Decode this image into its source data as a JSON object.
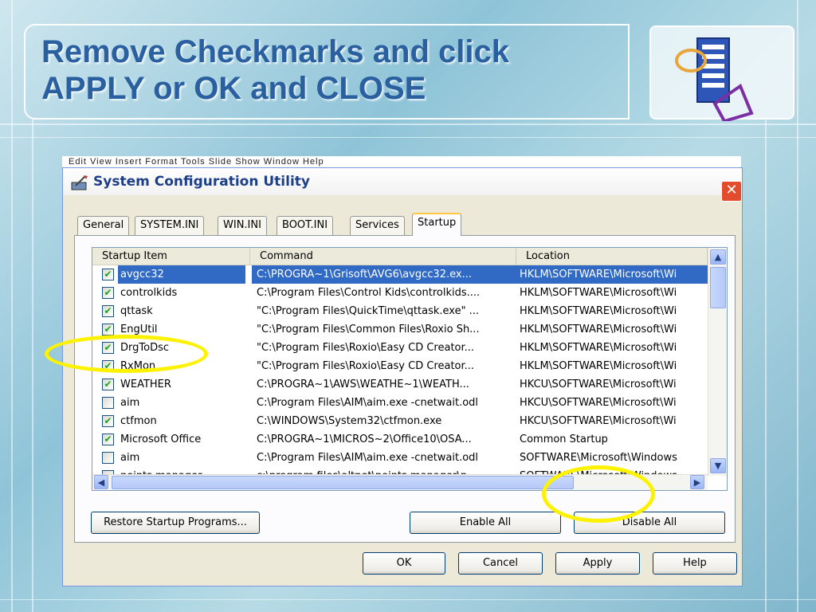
{
  "slide": {
    "title": "Remove Checkmarks and click APPLY or OK and CLOSE"
  },
  "background_menu": "Edit   View   Insert   Format   Tools   Slide Show   Window   Help",
  "window": {
    "title": "System Configuration Utility",
    "close": "✕"
  },
  "tabs": [
    "General",
    "SYSTEM.INI",
    "WIN.INI",
    "BOOT.INI",
    "Services",
    "Startup"
  ],
  "active_tab": "Startup",
  "list": {
    "headers": [
      "Startup Item",
      "Command",
      "Location"
    ],
    "rows": [
      {
        "checked": true,
        "item": "avgcc32",
        "command": "C:\\PROGRA~1\\Grisoft\\AVG6\\avgcc32.ex...",
        "location": "HKLM\\SOFTWARE\\Microsoft\\Wi",
        "selected": true
      },
      {
        "checked": true,
        "item": "controlkids",
        "command": "C:\\Program Files\\Control Kids\\controlkids....",
        "location": "HKLM\\SOFTWARE\\Microsoft\\Wi"
      },
      {
        "checked": true,
        "item": "qttask",
        "command": "\"C:\\Program Files\\QuickTime\\qttask.exe\" ...",
        "location": "HKLM\\SOFTWARE\\Microsoft\\Wi"
      },
      {
        "checked": true,
        "item": "EngUtil",
        "command": "\"C:\\Program Files\\Common Files\\Roxio Sh...",
        "location": "HKLM\\SOFTWARE\\Microsoft\\Wi"
      },
      {
        "checked": true,
        "item": "DrgToDsc",
        "command": "\"C:\\Program Files\\Roxio\\Easy CD Creator...",
        "location": "HKLM\\SOFTWARE\\Microsoft\\Wi"
      },
      {
        "checked": true,
        "item": "RxMon",
        "command": "\"C:\\Program Files\\Roxio\\Easy CD Creator...",
        "location": "HKLM\\SOFTWARE\\Microsoft\\Wi"
      },
      {
        "checked": true,
        "item": "WEATHER",
        "command": "C:\\PROGRA~1\\AWS\\WEATHE~1\\WEATH...",
        "location": "HKCU\\SOFTWARE\\Microsoft\\Wi"
      },
      {
        "checked": false,
        "item": "aim",
        "command": "C:\\Program Files\\AIM\\aim.exe -cnetwait.odl",
        "location": "HKCU\\SOFTWARE\\Microsoft\\Wi"
      },
      {
        "checked": true,
        "item": "ctfmon",
        "command": "C:\\WINDOWS\\System32\\ctfmon.exe",
        "location": "HKCU\\SOFTWARE\\Microsoft\\Wi"
      },
      {
        "checked": true,
        "item": "Microsoft Office",
        "command": "C:\\PROGRA~1\\MICROS~2\\Office10\\OSA...",
        "location": "Common Startup"
      },
      {
        "checked": false,
        "item": "aim",
        "command": "C:\\Program Files\\AIM\\aim.exe -cnetwait.odl",
        "location": "SOFTWARE\\Microsoft\\Windows"
      },
      {
        "checked": false,
        "item": "points manager",
        "command": "c:\\program files\\altnet\\points manager\\p...",
        "location": "SOFTWARE\\Microsoft\\Windows"
      }
    ]
  },
  "buttons": {
    "restore": "Restore Startup Programs...",
    "enable_all": "Enable All",
    "disable_all": "Disable All",
    "ok": "OK",
    "cancel": "Cancel",
    "apply": "Apply",
    "help": "Help"
  },
  "colors": {
    "title_text": "#2a5fa0",
    "highlight": "#fdf202",
    "selection": "#316ac5",
    "checkmark": "#21a121"
  },
  "icons": {
    "app": "system-config-icon",
    "logo": "network-document-logo"
  }
}
